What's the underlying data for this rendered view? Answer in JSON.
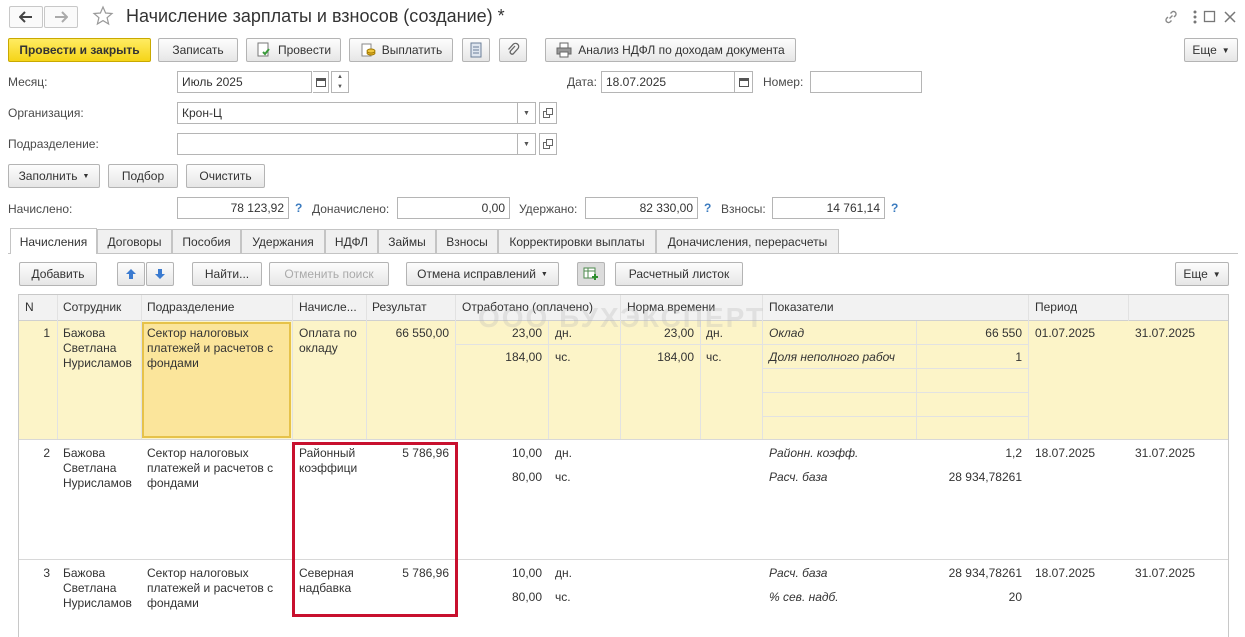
{
  "title": "Начисление зарплаты и взносов (создание) *",
  "toolbar": {
    "post_close": "Провести и закрыть",
    "save": "Записать",
    "post": "Провести",
    "pay": "Выплатить",
    "analysis": "Анализ НДФЛ по доходам документа",
    "more": "Еще"
  },
  "form": {
    "month_label": "Месяц:",
    "month_value": "Июль 2025",
    "date_label": "Дата:",
    "date_value": "18.07.2025",
    "number_label": "Номер:",
    "number_value": "",
    "org_label": "Организация:",
    "org_value": "Крон-Ц",
    "dept_label": "Подразделение:",
    "dept_value": ""
  },
  "fill_bar": {
    "fill": "Заполнить",
    "select": "Подбор",
    "clear": "Очистить"
  },
  "totals": {
    "accrued_label": "Начислено:",
    "accrued_value": "78 123,92",
    "extra_label": "Доначислено:",
    "extra_value": "0,00",
    "withheld_label": "Удержано:",
    "withheld_value": "82 330,00",
    "contrib_label": "Взносы:",
    "contrib_value": "14 761,14",
    "hint": "?"
  },
  "tabs": [
    "Начисления",
    "Договоры",
    "Пособия",
    "Удержания",
    "НДФЛ",
    "Займы",
    "Взносы",
    "Корректировки выплаты",
    "Доначисления, перерасчеты"
  ],
  "grid_toolbar": {
    "add": "Добавить",
    "find": "Найти...",
    "cancel_search": "Отменить поиск",
    "cancel_corrections": "Отмена исправлений",
    "payslip": "Расчетный листок",
    "more": "Еще"
  },
  "columns": [
    "N",
    "Сотрудник",
    "Подразделение",
    "Начисле...",
    "Результат",
    "Отработано (оплачено)",
    "Норма времени",
    "Показатели",
    "Период"
  ],
  "watermark": "ООО БУХЭКСПЕРТ",
  "rows": [
    {
      "n": "1",
      "employee": "Бажова Светлана Нурисламов",
      "dept": "Сектор налоговых платежей и расчетов с фондами",
      "accrual": "Оплата по окладу",
      "result": "66 550,00",
      "worked_days": "23,00",
      "worked_days_unit": "дн.",
      "worked_hours": "184,00",
      "worked_hours_unit": "чс.",
      "norm_days": "23,00",
      "norm_days_unit": "дн.",
      "norm_hours": "184,00",
      "norm_hours_unit": "чс.",
      "ind1_name": "Оклад",
      "ind1_value": "66 550",
      "ind2_name": "Доля неполного рабоч",
      "ind2_value": "1",
      "period_from": "01.07.2025",
      "period_to": "31.07.2025"
    },
    {
      "n": "2",
      "employee": "Бажова Светлана Нурисламов",
      "dept": "Сектор налоговых платежей и расчетов с фондами",
      "accrual": "Районный коэффици",
      "result": "5 786,96",
      "worked_days": "10,00",
      "worked_days_unit": "дн.",
      "worked_hours": "80,00",
      "worked_hours_unit": "чс.",
      "ind1_name": "Районн. коэфф.",
      "ind1_value": "1,2",
      "ind2_name": "Расч. база",
      "ind2_value": "28 934,78261",
      "period_from": "18.07.2025",
      "period_to": "31.07.2025"
    },
    {
      "n": "3",
      "employee": "Бажова Светлана Нурисламов",
      "dept": "Сектор налоговых платежей и расчетов с фондами",
      "accrual": "Северная надбавка",
      "result": "5 786,96",
      "worked_days": "10,00",
      "worked_days_unit": "дн.",
      "worked_hours": "80,00",
      "worked_hours_unit": "чс.",
      "ind1_name": "Расч. база",
      "ind1_value": "28 934,78261",
      "ind2_name": "% сев. надб.",
      "ind2_value": "20",
      "period_from": "18.07.2025",
      "period_to": "31.07.2025"
    }
  ],
  "colors": {
    "primary": "#f5d418",
    "row_selected": "#fcf4c8",
    "cell_current": "#fbe59b",
    "highlight_frame": "#c8102e",
    "hint": "#3b7bbf"
  }
}
